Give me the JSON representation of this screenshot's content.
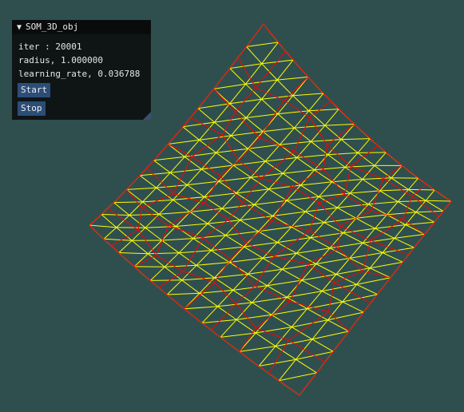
{
  "window": {
    "title": "SOM_3D_obj",
    "collapse_icon": "triangle-down-icon",
    "iter_text": "iter : 20001",
    "radius_text": "radius, 1.000000",
    "learning_rate_text": "learning_rate, 0.036788",
    "start_label": "Start",
    "stop_label": "Stop"
  },
  "scene": {
    "background": "#2f4f4f",
    "mesh_color": "#ffff00",
    "som_color": "#ff0000"
  }
}
